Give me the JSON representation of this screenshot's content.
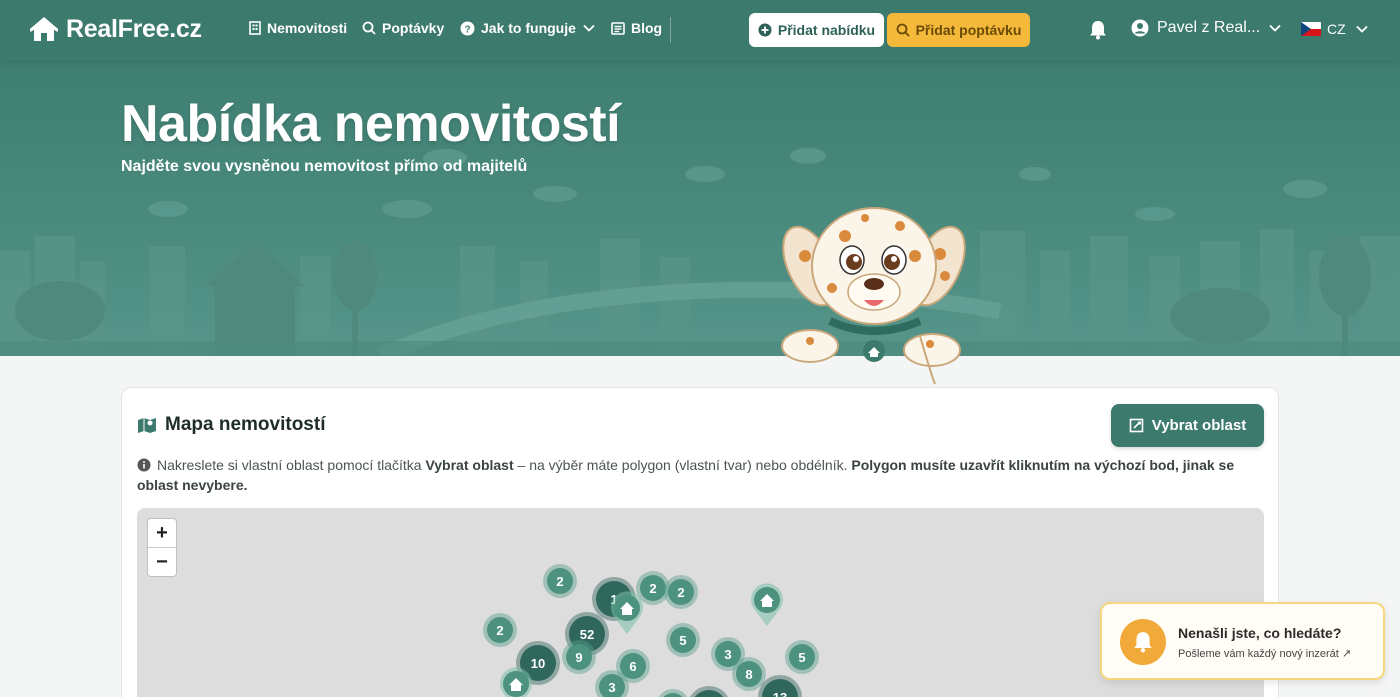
{
  "brand": {
    "name": "RealFree.cz"
  },
  "nav": {
    "links": [
      {
        "label": "Nemovitosti",
        "icon": "building-icon"
      },
      {
        "label": "Poptávky",
        "icon": "search-icon"
      },
      {
        "label": "Jak to funguje",
        "icon": "question-circle-icon"
      },
      {
        "label": "Blog",
        "icon": "newspaper-icon"
      }
    ],
    "add_offer_label": "Přidat nabídku",
    "add_demand_label": "Přidat poptávku",
    "user_name": "Pavel z Real...",
    "language": "CZ"
  },
  "hero": {
    "title": "Nabídka nemovitostí",
    "subtitle": "Najděte svou vysněnou nemovitost přímo od majitelů"
  },
  "map_section": {
    "title": "Mapa nemovitostí",
    "select_area_label": "Vybrat oblast",
    "hint_part1": "Nakreslete si vlastní oblast pomocí tlačítka ",
    "hint_bold1": "Vybrat oblast",
    "hint_part2": " – na výběr máte polygon (vlastní tvar) nebo obdélník. ",
    "hint_bold2": "Polygon musíte uzavřít kliknutím na výchozí bod, jinak se oblast nevybere.",
    "zoom_in": "+",
    "zoom_out": "−",
    "clusters": [
      "2",
      "1",
      "2",
      "2",
      "2",
      "52",
      "5",
      "10",
      "9",
      "6",
      "3",
      "8",
      "5",
      "3",
      "13"
    ]
  },
  "toast": {
    "title": "Nenašli jste, co hledáte?",
    "subtitle": "Pošleme vám každý nový inzerát ↗"
  },
  "colors": {
    "primary": "#3d7a6e",
    "accent": "#f4b93a",
    "cluster": "#4d927f"
  }
}
